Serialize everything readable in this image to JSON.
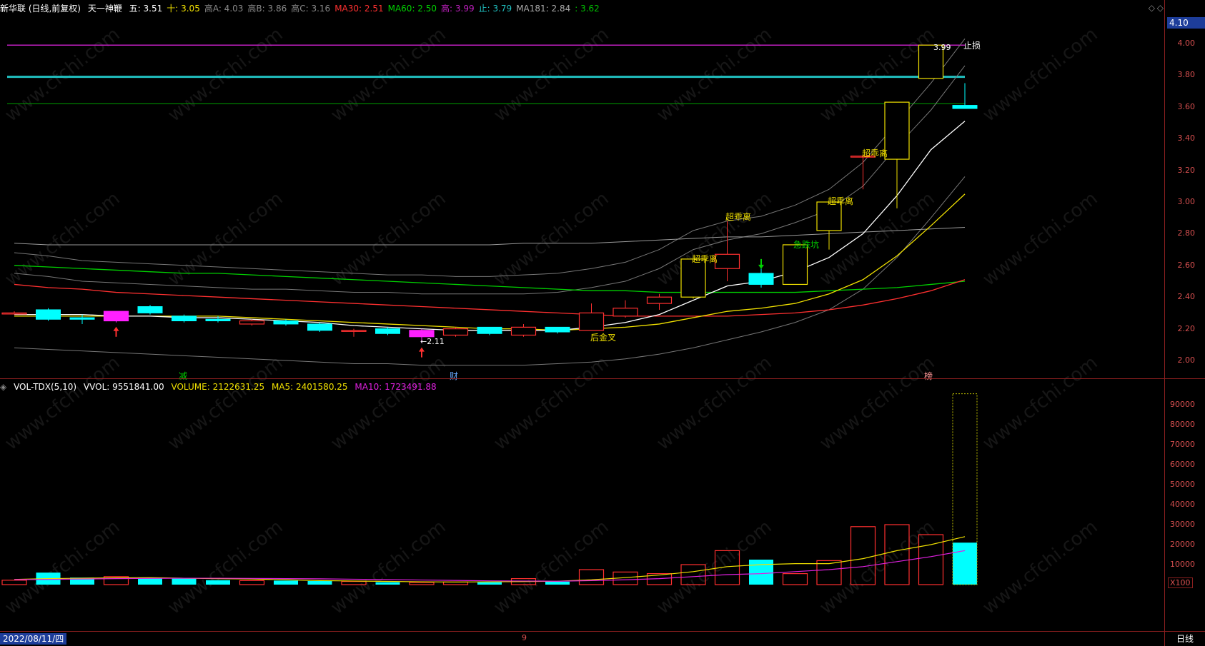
{
  "main_header": {
    "stock": "新华联 (日线,前复权)",
    "indicator": "天一神鞭",
    "items": [
      {
        "label": "五: 3.51",
        "color": "#ffffff"
      },
      {
        "label": "十: 3.05",
        "color": "#f0e000"
      },
      {
        "label": "高A: 4.03",
        "color": "#888888"
      },
      {
        "label": "高B: 3.86",
        "color": "#888888"
      },
      {
        "label": "高C: 3.16",
        "color": "#888888"
      },
      {
        "label": "MA30: 2.51",
        "color": "#ff3030"
      },
      {
        "label": "MA60: 2.50",
        "color": "#00d000"
      },
      {
        "label": "高: 3.99",
        "color": "#c020c0"
      },
      {
        "label": "止: 3.79",
        "color": "#20c0c0"
      },
      {
        "label": "MA181: 2.84",
        "color": "#aaaaaa"
      },
      {
        "label": ": 3.62",
        "color": "#00c000"
      }
    ]
  },
  "current_price_tag": "4.10",
  "price_axis": [
    "4.00",
    "3.80",
    "3.60",
    "3.40",
    "3.20",
    "3.00",
    "2.80",
    "2.60",
    "2.40",
    "2.20",
    "2.00"
  ],
  "vol_header": {
    "indicator": "VOL-TDX(5,10)",
    "vvol": "VVOL: 9551841.00",
    "volume": "VOLUME: 2122631.25",
    "ma5": "MA5: 2401580.25",
    "ma10": "MA10: 1723491.88"
  },
  "vol_axis": [
    "90000",
    "80000",
    "70000",
    "60000",
    "50000",
    "40000",
    "30000",
    "20000",
    "10000"
  ],
  "vol_unit": "X100",
  "annotations": {
    "stop_loss": "止损",
    "high_price": "3.99",
    "low_price": "←2.11",
    "golden_cross": "后金叉",
    "divergence_1": "超乖离",
    "divergence_2": "超乖离",
    "divergence_3": "超乖离",
    "divergence_4": "超乖离",
    "dip": "急跌坑",
    "marker_reduce": "减",
    "marker_finance": "财",
    "marker_rank": "榜"
  },
  "bottom": {
    "date": "2022/08/11/四",
    "month_mark": "9",
    "period": "日线"
  },
  "watermark": "www.cfchi.com",
  "colors": {
    "up": "#ff3030",
    "down": "#00ffff",
    "ma5": "#ffffff",
    "ma10": "#f0e000",
    "ma30": "#ff3030",
    "ma60": "#00d000",
    "ma181": "#aaaaaa",
    "purple": "#c020c0",
    "teal": "#20c0c0"
  },
  "chart_data": {
    "type": "candlestick",
    "ylim": [
      1.95,
      4.1
    ],
    "candles": [
      {
        "o": 2.3,
        "c": 2.3,
        "h": 2.31,
        "l": 2.29
      },
      {
        "o": 2.32,
        "c": 2.26,
        "h": 2.33,
        "l": 2.25
      },
      {
        "o": 2.27,
        "c": 2.26,
        "h": 2.29,
        "l": 2.23
      },
      {
        "o": 2.25,
        "c": 2.31,
        "h": 2.31,
        "l": 2.24
      },
      {
        "o": 2.34,
        "c": 2.3,
        "h": 2.35,
        "l": 2.29
      },
      {
        "o": 2.28,
        "c": 2.25,
        "h": 2.29,
        "l": 2.24
      },
      {
        "o": 2.26,
        "c": 2.25,
        "h": 2.28,
        "l": 2.24
      },
      {
        "o": 2.23,
        "c": 2.25,
        "h": 2.26,
        "l": 2.22
      },
      {
        "o": 2.25,
        "c": 2.23,
        "h": 2.26,
        "l": 2.22
      },
      {
        "o": 2.23,
        "c": 2.19,
        "h": 2.24,
        "l": 2.18
      },
      {
        "o": 2.19,
        "c": 2.19,
        "h": 2.2,
        "l": 2.15
      },
      {
        "o": 2.2,
        "c": 2.17,
        "h": 2.21,
        "l": 2.16
      },
      {
        "o": 2.15,
        "c": 2.19,
        "h": 2.2,
        "l": 2.11
      },
      {
        "o": 2.16,
        "c": 2.2,
        "h": 2.21,
        "l": 2.15
      },
      {
        "o": 2.21,
        "c": 2.17,
        "h": 2.21,
        "l": 2.16
      },
      {
        "o": 2.16,
        "c": 2.21,
        "h": 2.23,
        "l": 2.15
      },
      {
        "o": 2.21,
        "c": 2.18,
        "h": 2.21,
        "l": 2.17
      },
      {
        "o": 2.19,
        "c": 2.3,
        "h": 2.36,
        "l": 2.19
      },
      {
        "o": 2.28,
        "c": 2.33,
        "h": 2.38,
        "l": 2.27
      },
      {
        "o": 2.36,
        "c": 2.4,
        "h": 2.42,
        "l": 2.32
      },
      {
        "o": 2.4,
        "c": 2.64,
        "h": 2.64,
        "l": 2.39
      },
      {
        "o": 2.58,
        "c": 2.67,
        "h": 2.88,
        "l": 2.5
      },
      {
        "o": 2.55,
        "c": 2.48,
        "h": 2.58,
        "l": 2.46
      },
      {
        "o": 2.48,
        "c": 2.73,
        "h": 2.73,
        "l": 2.48
      },
      {
        "o": 2.82,
        "c": 3.0,
        "h": 3.0,
        "l": 2.7
      },
      {
        "o": 3.29,
        "c": 3.29,
        "h": 3.29,
        "l": 3.08
      },
      {
        "o": 3.27,
        "c": 3.63,
        "h": 3.63,
        "l": 2.96
      },
      {
        "o": 3.78,
        "c": 3.99,
        "h": 3.99,
        "l": 3.78
      },
      {
        "o": 3.61,
        "c": 3.59,
        "h": 3.75,
        "l": 3.59
      }
    ],
    "ma5": [
      2.29,
      2.29,
      2.29,
      2.28,
      2.28,
      2.27,
      2.27,
      2.26,
      2.25,
      2.24,
      2.22,
      2.21,
      2.2,
      2.19,
      2.19,
      2.19,
      2.19,
      2.21,
      2.24,
      2.29,
      2.38,
      2.47,
      2.5,
      2.56,
      2.65,
      2.8,
      3.04,
      3.33,
      3.51
    ],
    "ma10": [
      2.28,
      2.28,
      2.28,
      2.28,
      2.28,
      2.28,
      2.28,
      2.27,
      2.26,
      2.25,
      2.24,
      2.23,
      2.22,
      2.21,
      2.2,
      2.2,
      2.19,
      2.2,
      2.21,
      2.23,
      2.27,
      2.31,
      2.33,
      2.36,
      2.42,
      2.51,
      2.66,
      2.85,
      3.05
    ],
    "ma30": [
      2.48,
      2.46,
      2.45,
      2.43,
      2.42,
      2.41,
      2.4,
      2.39,
      2.38,
      2.37,
      2.36,
      2.35,
      2.34,
      2.33,
      2.32,
      2.31,
      2.3,
      2.29,
      2.28,
      2.28,
      2.28,
      2.28,
      2.29,
      2.3,
      2.32,
      2.35,
      2.39,
      2.44,
      2.51
    ],
    "ma60": [
      2.6,
      2.59,
      2.58,
      2.57,
      2.56,
      2.55,
      2.55,
      2.54,
      2.53,
      2.52,
      2.51,
      2.5,
      2.49,
      2.48,
      2.47,
      2.46,
      2.45,
      2.44,
      2.44,
      2.43,
      2.43,
      2.43,
      2.43,
      2.43,
      2.44,
      2.45,
      2.46,
      2.48,
      2.5
    ],
    "ma181": [
      2.74,
      2.73,
      2.73,
      2.73,
      2.73,
      2.73,
      2.73,
      2.73,
      2.73,
      2.73,
      2.73,
      2.73,
      2.73,
      2.73,
      2.73,
      2.74,
      2.74,
      2.74,
      2.75,
      2.76,
      2.77,
      2.78,
      2.78,
      2.79,
      2.8,
      2.81,
      2.82,
      2.83,
      2.84
    ],
    "band_high_a": [
      2.68,
      2.66,
      2.63,
      2.62,
      2.61,
      2.6,
      2.59,
      2.58,
      2.57,
      2.56,
      2.55,
      2.54,
      2.54,
      2.53,
      2.53,
      2.54,
      2.55,
      2.58,
      2.62,
      2.7,
      2.82,
      2.88,
      2.91,
      2.98,
      3.08,
      3.25,
      3.5,
      3.75,
      4.03
    ],
    "band_high_b": [
      2.55,
      2.53,
      2.5,
      2.49,
      2.48,
      2.47,
      2.46,
      2.45,
      2.45,
      2.44,
      2.43,
      2.43,
      2.42,
      2.42,
      2.42,
      2.42,
      2.43,
      2.46,
      2.5,
      2.58,
      2.7,
      2.76,
      2.8,
      2.87,
      2.95,
      3.1,
      3.35,
      3.58,
      3.86
    ],
    "band_low": [
      2.08,
      2.07,
      2.06,
      2.05,
      2.04,
      2.03,
      2.02,
      2.01,
      2.0,
      1.99,
      1.98,
      1.98,
      1.97,
      1.97,
      1.97,
      1.97,
      1.98,
      1.99,
      2.01,
      2.04,
      2.08,
      2.13,
      2.18,
      2.24,
      2.32,
      2.45,
      2.65,
      2.9,
      3.16
    ],
    "levels": {
      "high": 3.99,
      "stop": 3.79,
      "mid": 3.62
    },
    "volume": {
      "ylim": [
        0,
        100000
      ],
      "values": [
        2200,
        6000,
        3500,
        4000,
        3500,
        3000,
        2200,
        2000,
        2000,
        1800,
        1600,
        1200,
        1100,
        1300,
        1200,
        3000,
        1500,
        7500,
        6300,
        5500,
        10000,
        17000,
        12500,
        5500,
        12000,
        29000,
        30000,
        25000,
        21000
      ],
      "ma5": [
        2600,
        3000,
        3200,
        3400,
        3500,
        3200,
        3000,
        2800,
        2400,
        2000,
        1800,
        1600,
        1400,
        1300,
        1400,
        1500,
        1700,
        2400,
        3500,
        4800,
        6500,
        9000,
        10000,
        10500,
        10500,
        13000,
        17000,
        20000,
        24000
      ],
      "ma10": [
        2500,
        2600,
        2800,
        3000,
        3100,
        3200,
        3200,
        3100,
        3000,
        2900,
        2700,
        2500,
        2300,
        2100,
        1900,
        1800,
        1700,
        2000,
        2400,
        3000,
        4000,
        5000,
        5500,
        6500,
        7500,
        9000,
        11500,
        14000,
        17000
      ],
      "extra_bar": 95500
    }
  }
}
